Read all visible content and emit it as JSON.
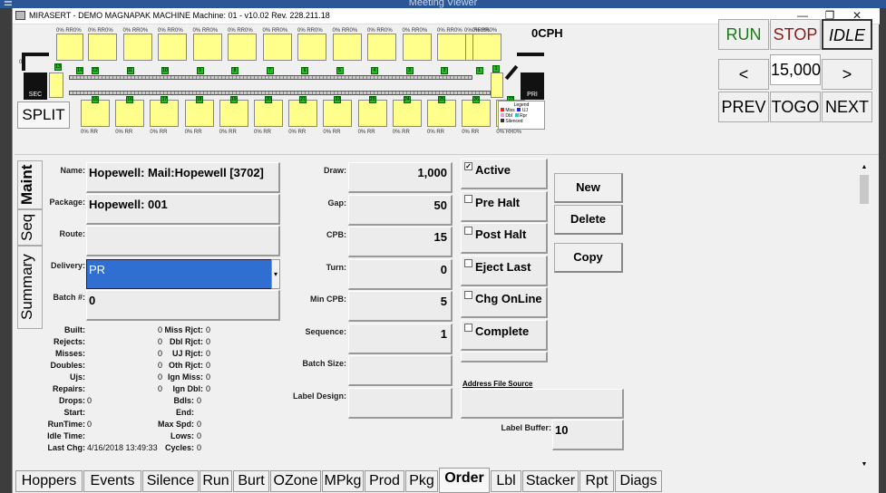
{
  "meeting_title": "Meeting Viewer",
  "window_title": "MIRASERT - DEMO MAGNAPAK  MACHINE Machine: 01 - v10.02 Rev. 228.211.18",
  "cph": "0CPH",
  "split_label": "SPLIT",
  "sec_label": "SEC",
  "pri_label": "PRI",
  "legend": {
    "title": "Legend",
    "miss": "Miss",
    "dbl": "Dbl",
    "silenced": "Silenced",
    "uj": "UJ",
    "rpr": "Rpr"
  },
  "top_labels": {
    "left": "0% RR0%",
    "top": "0% RR0%",
    "bottom": "0% RR",
    "bottom_end": "0% RR0%"
  },
  "top_hopper_numbers": [
    "12",
    "11",
    "10",
    "9",
    "8",
    "7",
    "6",
    "5",
    "4",
    "3",
    "2",
    "1"
  ],
  "bottom_hopper_numbers": [
    "15",
    "16",
    "17",
    "18",
    "19",
    "20",
    "21",
    "22",
    "23",
    "24",
    "25",
    "26",
    "27"
  ],
  "controls": {
    "run": "RUN",
    "stop": "STOP",
    "idle": "IDLE",
    "prev_arrow": "<",
    "count": "15,000",
    "next_arrow": ">",
    "prev": "PREV",
    "togo": "TOGO",
    "next": "NEXT"
  },
  "vtabs": [
    "Maint",
    "Seq",
    "Summary"
  ],
  "form": {
    "name_label": "Name:",
    "name_value": "Hopewell: Mail:Hopewell [3702]",
    "package_label": "Package:",
    "package_value": "Hopewell: 001",
    "route_label": "Route:",
    "route_value": "",
    "delivery_label": "Delivery:",
    "delivery_value": "PR",
    "batch_label": "Batch #:",
    "batch_value": "0",
    "draw_label": "Draw:",
    "draw_value": "1,000",
    "gap_label": "Gap:",
    "gap_value": "50",
    "cpb_label": "CPB:",
    "cpb_value": "15",
    "turn_label": "Turn:",
    "turn_value": "0",
    "mincpb_label": "Min CPB:",
    "mincpb_value": "5",
    "sequence_label": "Sequence:",
    "sequence_value": "1",
    "batchsize_label": "Batch Size:",
    "batchsize_value": "",
    "labeldesign_label": "Label Design:",
    "labeldesign_value": "",
    "address_file_source": "Address File Source",
    "label_buffer_label": "Label Buffer:",
    "label_buffer_value": "10"
  },
  "checkboxes": [
    {
      "label": "Active",
      "checked": "✓"
    },
    {
      "label": "Pre Halt",
      "checked": ""
    },
    {
      "label": "Post Halt",
      "checked": ""
    },
    {
      "label": "Eject Last",
      "checked": ""
    },
    {
      "label": "Chg OnLine",
      "checked": ""
    },
    {
      "label": "Complete",
      "checked": ""
    }
  ],
  "actions": {
    "new": "New",
    "delete": "Delete",
    "copy": "Copy"
  },
  "stats_left": [
    {
      "label": "Built:",
      "value": "0"
    },
    {
      "label": "Rejects:",
      "value": "0"
    },
    {
      "label": "Misses:",
      "value": "0"
    },
    {
      "label": "Doubles:",
      "value": "0"
    },
    {
      "label": "Ujs:",
      "value": "0"
    },
    {
      "label": "Repairs:",
      "value": "0"
    }
  ],
  "stats_right": [
    {
      "label": "Miss Rjct:",
      "value": "0"
    },
    {
      "label": "Dbl Rjct:",
      "value": "0"
    },
    {
      "label": "UJ Rjct:",
      "value": "0"
    },
    {
      "label": "Oth Rjct:",
      "value": "0"
    },
    {
      "label": "Ign Miss:",
      "value": "0"
    },
    {
      "label": "Ign Dbl:",
      "value": "0"
    }
  ],
  "stats_bottom_left": [
    {
      "label": "Drops:",
      "value": "0"
    },
    {
      "label": "Start:",
      "value": ""
    },
    {
      "label": "RunTime:",
      "value": "0"
    },
    {
      "label": "Idle Time:",
      "value": ""
    },
    {
      "label": "Last Chg:",
      "value": "4/16/2018 13:49:33"
    }
  ],
  "stats_bottom_right": [
    {
      "label": "Bdls:",
      "value": "0"
    },
    {
      "label": "End:",
      "value": ""
    },
    {
      "label": "Max Spd:",
      "value": "0"
    },
    {
      "label": "Lows:",
      "value": "0"
    },
    {
      "label": "Cycles:",
      "value": "0"
    }
  ],
  "bottom_tabs": [
    "Hoppers",
    "Events",
    "Silence",
    "Run",
    "Burt",
    "OZone",
    "MPkg",
    "Prod",
    "Pkg",
    "Order",
    "Lbl",
    "Stacker",
    "Rpt",
    "Diags"
  ],
  "active_tab": "Order",
  "colors": {
    "run": "#1a7a1a",
    "stop": "#8b1a1a",
    "hopper": "#ffff8c",
    "delivery_bg": "#2e6fd1",
    "titlebar": "#2b5797"
  }
}
